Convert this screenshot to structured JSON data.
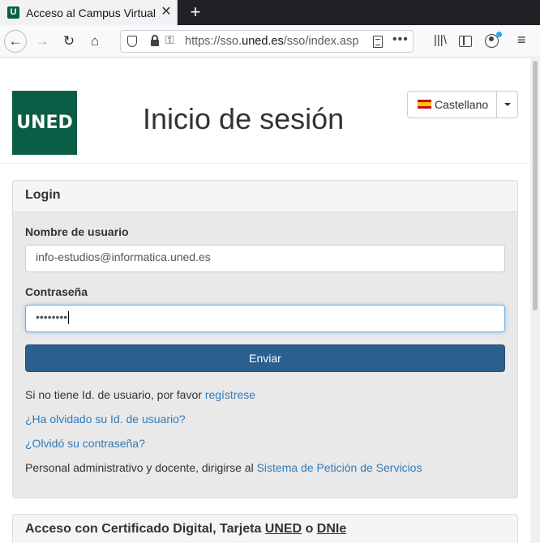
{
  "browser": {
    "tab": {
      "favicon_letter": "U",
      "title": "Acceso al Campus Virtual",
      "close_glyph": "✕"
    },
    "newtab_glyph": "+",
    "nav": {
      "back_glyph": "←",
      "forward_glyph": "→",
      "reload_glyph": "↻",
      "home_glyph": "⌂"
    },
    "url": {
      "prefix": "https://sso.",
      "domain": "uned.es",
      "path": "/sso/index.asp"
    },
    "url_more_glyph": "•••",
    "library_glyph": "|||\\",
    "menu_glyph": "≡"
  },
  "header": {
    "logo_text": "UNED",
    "title": "Inicio de sesión",
    "language": "Castellano"
  },
  "login": {
    "heading": "Login",
    "username_label": "Nombre de usuario",
    "username_value": "info-estudios@informatica.uned.es",
    "password_label": "Contraseña",
    "password_value": "••••••••",
    "submit_label": "Enviar",
    "register_prefix": "Si no tiene Id. de usuario, por favor ",
    "register_link": "regístrese",
    "forgot_id_link": "¿Ha olvidado su Id. de usuario?",
    "forgot_password_link": "¿Olvidó su contraseña?",
    "staff_prefix": "Personal administrativo y docente, dirigirse al ",
    "staff_link": "Sistema de Petición de Servicios"
  },
  "certificate": {
    "heading_part1": "Acceso con Certificado Digital, Tarjeta ",
    "heading_uned": "UNED",
    "heading_part2": " o ",
    "heading_dnie": "DNIe"
  },
  "colors": {
    "brand": "#0b5e45",
    "button": "#2b5f8f",
    "link": "#337ab7"
  }
}
